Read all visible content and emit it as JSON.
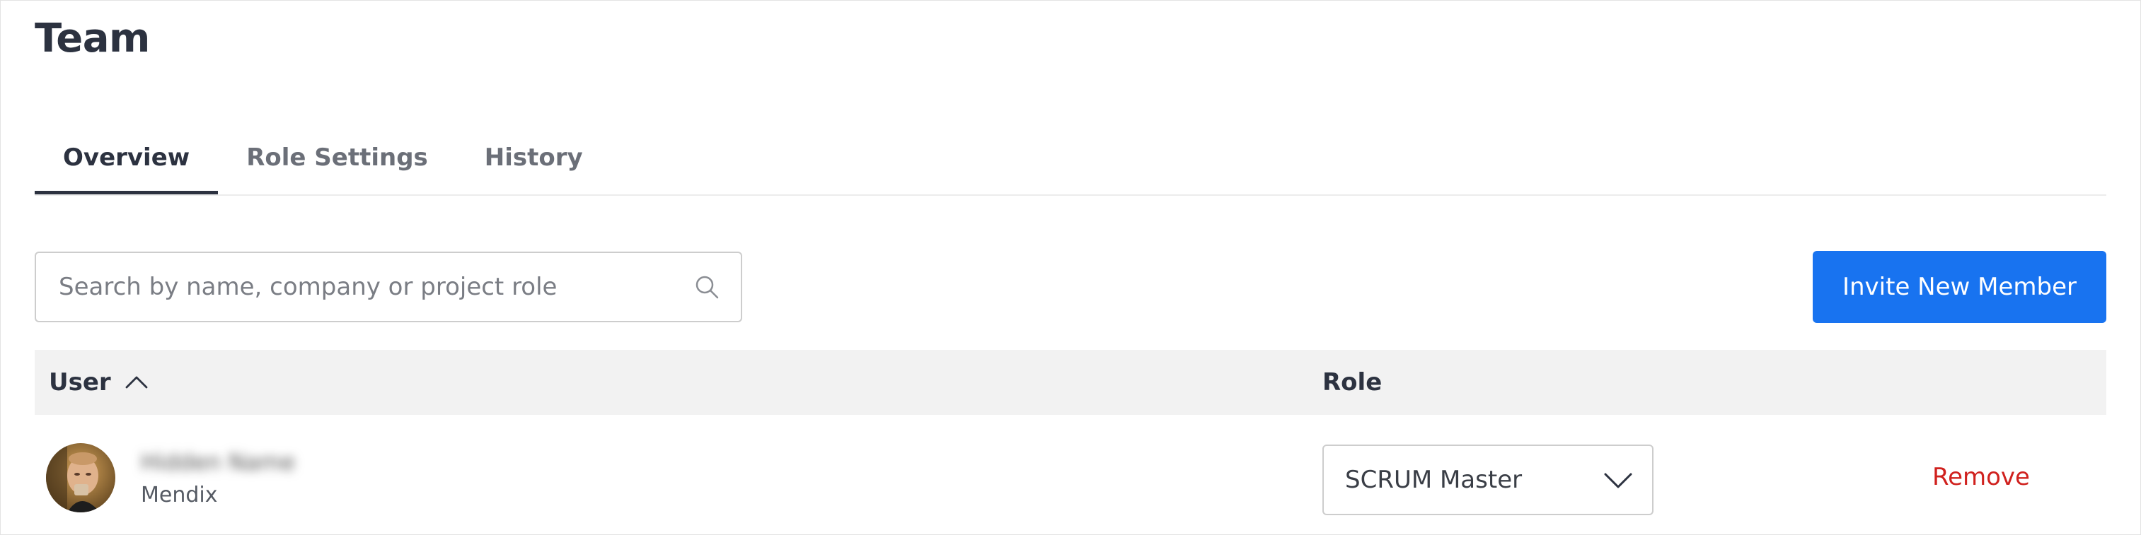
{
  "page": {
    "title": "Team"
  },
  "tabs": [
    {
      "label": "Overview",
      "active": true
    },
    {
      "label": "Role Settings",
      "active": false
    },
    {
      "label": "History",
      "active": false
    }
  ],
  "search": {
    "placeholder": "Search by name, company or project role",
    "value": "",
    "icon": "search-icon"
  },
  "actions": {
    "invite_label": "Invite New Member",
    "invite_color": "#1873f0"
  },
  "table": {
    "columns": {
      "user": "User",
      "role": "Role"
    },
    "sort": {
      "column": "user",
      "direction": "ascending",
      "icon": "chevron-up-icon"
    },
    "rows": [
      {
        "name": "Hidden Name",
        "company": "Mendix",
        "role": "SCRUM Master",
        "remove_label": "Remove"
      }
    ]
  },
  "colors": {
    "remove": "#d0211e",
    "text": "#2c3240"
  }
}
